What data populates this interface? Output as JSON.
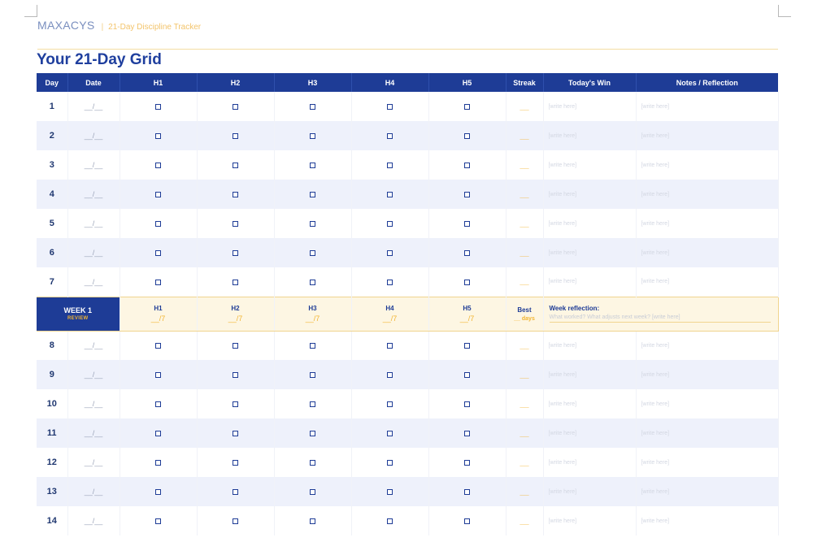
{
  "header": {
    "brand": "MAXACYS",
    "separator": "|",
    "subtitle": "21-Day Discipline Tracker"
  },
  "page_title": "Your 21-Day Grid",
  "columns": [
    "Day",
    "Date",
    "H1",
    "H2",
    "H3",
    "H4",
    "H5",
    "Streak",
    "Today's Win",
    "Notes / Reflection"
  ],
  "row_defaults": {
    "date_blank": "__/__",
    "streak_blank": "__",
    "write_placeholder": "[write here]"
  },
  "days_before_review": [
    "1",
    "2",
    "3",
    "4",
    "5",
    "6",
    "7"
  ],
  "week_review": {
    "title": "WEEK 1",
    "subtitle": "REVIEW",
    "habits": [
      {
        "label": "H1",
        "value": "__/7"
      },
      {
        "label": "H2",
        "value": "__/7"
      },
      {
        "label": "H3",
        "value": "__/7"
      },
      {
        "label": "H4",
        "value": "__/7"
      },
      {
        "label": "H5",
        "value": "__/7"
      }
    ],
    "best_label": "Best",
    "best_value": "__ days",
    "reflection_label": "Week reflection:",
    "reflection_prompt": "What worked? What adjusts next week? [write here]"
  },
  "days_after_review": [
    "8",
    "9",
    "10",
    "11",
    "12",
    "13",
    "14"
  ]
}
